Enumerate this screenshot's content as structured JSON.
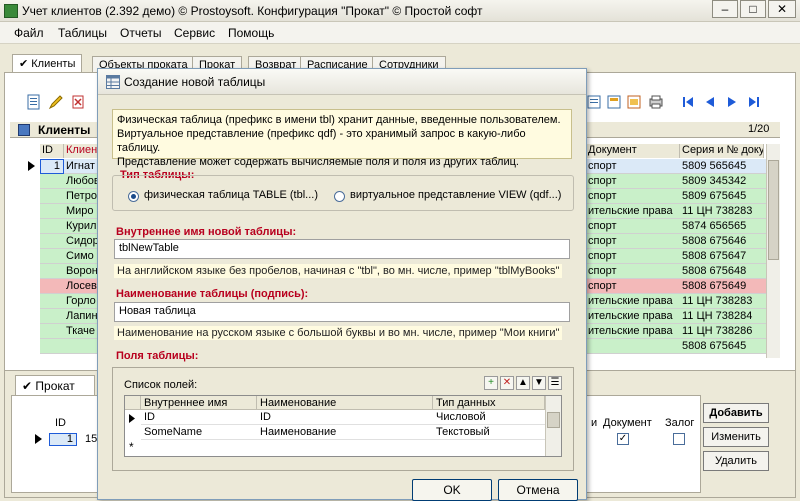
{
  "window": {
    "title": "Учет клиентов (2.392 демо) © Prostoysoft. Конфигурация \"Прокат\" © Простой софт",
    "min_label": "–",
    "max_label": "□",
    "close_label": "✕"
  },
  "menu": [
    "Файл",
    "Таблицы",
    "Отчеты",
    "Сервис",
    "Помощь"
  ],
  "tabs": [
    {
      "label": "✔ Клиенты"
    },
    {
      "label": "Объекты проката"
    },
    {
      "label": "Прокат"
    },
    {
      "label": "Возврат"
    },
    {
      "label": "Расписание"
    },
    {
      "label": "Сотрудники"
    }
  ],
  "grid": {
    "title": "Клиенты",
    "page_counter": "1/20",
    "columns": [
      "ID",
      "Клиент",
      "Документ",
      "Серия и № доку"
    ],
    "rows": [
      {
        "id": "1",
        "name": "Игнат",
        "doc": "спорт",
        "series": "5809 565645",
        "color": "#dbe9f7"
      },
      {
        "id": "",
        "name": "Любов",
        "doc": "спорт",
        "series": "5809 345342",
        "color": "#c9f0c9"
      },
      {
        "id": "",
        "name": "Петро",
        "doc": "спорт",
        "series": "5809 675645",
        "color": "#c9f0c9"
      },
      {
        "id": "",
        "name": "Миро",
        "doc": "ительские права",
        "series": "11 ЦН 738283",
        "color": "#c9f0c9"
      },
      {
        "id": "",
        "name": "Курил",
        "doc": "спорт",
        "series": "5874 656565",
        "color": "#c9f0c9"
      },
      {
        "id": "",
        "name": "Сидор",
        "doc": "спорт",
        "series": "5808 675646",
        "color": "#c9f0c9"
      },
      {
        "id": "",
        "name": "Симо",
        "doc": "спорт",
        "series": "5808 675647",
        "color": "#c9f0c9"
      },
      {
        "id": "",
        "name": "Ворон",
        "doc": "спорт",
        "series": "5808 675648",
        "color": "#c9f0c9"
      },
      {
        "id": "",
        "name": "Лосев",
        "doc": "спорт",
        "series": "5808 675649",
        "color": "#f3b9b9"
      },
      {
        "id": "",
        "name": "Горло",
        "doc": "ительские права",
        "series": "11 ЦН 738283",
        "color": "#c9f0c9"
      },
      {
        "id": "",
        "name": "Лапин",
        "doc": "ительские права",
        "series": "11 ЦН 738284",
        "color": "#c9f0c9"
      },
      {
        "id": "",
        "name": "Ткаче",
        "doc": "ительские права",
        "series": "11 ЦН 738286",
        "color": "#c9f0c9"
      },
      {
        "id": "",
        "name": "",
        "doc": "",
        "series": "5808 675645",
        "color": "#c9f0c9"
      }
    ]
  },
  "lower": {
    "tab_label": "✔ Прокат",
    "id_header": "ID",
    "row_id": "1",
    "row_rest": "15",
    "col_doc": "Документ",
    "col_zalog": "Залог",
    "col_i": "и",
    "add_button": "Добавить",
    "edit_button": "Изменить",
    "delete_button": "Удалить"
  },
  "dialog": {
    "title": "Создание новой таблицы",
    "info": [
      "Физическая таблица (префикс в имени tbl) хранит данные, введенные пользователем.",
      "Виртуальное представление (префикс qdf) - это хранимый запрос в какую-либо таблицу.",
      "Представление может содержать вычисляемые поля и поля из других таблиц."
    ],
    "type_title": "Тип таблицы:",
    "radio_physical": "физическая таблица TABLE (tbl...)",
    "radio_virtual": "виртуальное представление VIEW (qdf...)",
    "internal_title": "Внутреннее имя новой таблицы:",
    "internal_value": "tblNewTable",
    "internal_hint": "На английском языке без пробелов, начиная с \"tbl\", во мн. числе, пример \"tblMyBooks\"",
    "caption_title": "Наименование таблицы (подпись):",
    "caption_value": "Новая таблица",
    "caption_hint": "Наименование на русском языке с большой буквы и во мн. числе, пример \"Мои книги\"",
    "fields_title": "Поля таблицы:",
    "fields_list_label": "Список полей:",
    "fields_columns": [
      "Внутреннее имя",
      "Наименование",
      "Тип данных"
    ],
    "fields_rows": [
      {
        "internal": "ID",
        "caption": "ID",
        "type": "Числовой"
      },
      {
        "internal": "SomeName",
        "caption": "Наименование",
        "type": "Текстовый"
      }
    ],
    "new_row_marker": "*",
    "ok_button": "OK",
    "cancel_button": "Отмена"
  },
  "colors": {
    "section_title": "#b8001e",
    "hint_bg": "#fffbe0",
    "row_green": "#c9f0c9",
    "row_red": "#f3b9b9",
    "nav_arrow": "#1e5bd8"
  }
}
